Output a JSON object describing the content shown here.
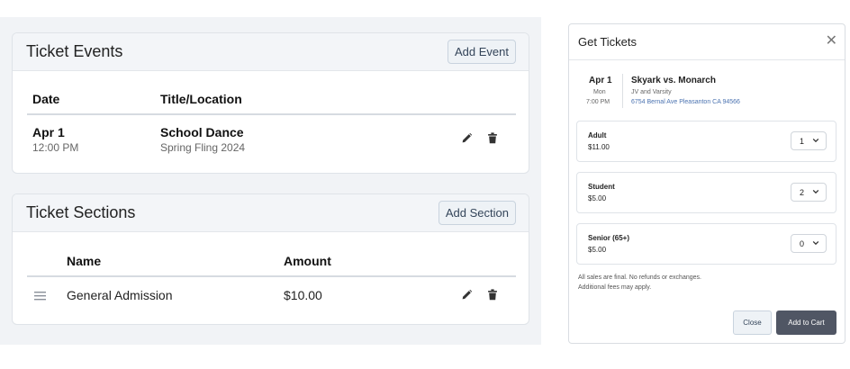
{
  "ticket_events": {
    "title": "Ticket Events",
    "add_button": "Add Event",
    "columns": {
      "date": "Date",
      "title": "Title/Location"
    },
    "rows": [
      {
        "date": "Apr 1",
        "time": "12:00 PM",
        "title": "School Dance",
        "subtitle": "Spring Fling 2024"
      }
    ]
  },
  "ticket_sections": {
    "title": "Ticket Sections",
    "add_button": "Add Section",
    "columns": {
      "name": "Name",
      "amount": "Amount"
    },
    "rows": [
      {
        "name": "General Admission",
        "amount": "$10.00"
      }
    ]
  },
  "modal": {
    "title": "Get Tickets",
    "close_glyph": "✕",
    "event": {
      "month_day": "Apr 1",
      "weekday": "Mon",
      "time": "7:00 PM",
      "title": "Skyark vs. Monarch",
      "subtitle": "JV and Varsity",
      "address": "6754 Bernal Ave Pleasanton CA 94566"
    },
    "tiers": [
      {
        "name": "Adult",
        "price": "$11.00",
        "quantity": "1"
      },
      {
        "name": "Student",
        "price": "$5.00",
        "quantity": "2"
      },
      {
        "name": "Senior (65+)",
        "price": "$5.00",
        "quantity": "0"
      }
    ],
    "notes": [
      "All sales are final. No refunds or exchanges.",
      "Additional fees may apply."
    ],
    "close_button": "Close",
    "add_to_cart_button": "Add to Cart"
  },
  "icons": {
    "edit": "pencil-icon",
    "delete": "trash-icon",
    "drag": "drag-handle-icon",
    "close": "close-icon",
    "dropdown": "chevron-down-icon"
  },
  "colors": {
    "primary_button": "#505664",
    "link": "#4a72b0",
    "header_bg": "#f3f5f8"
  }
}
